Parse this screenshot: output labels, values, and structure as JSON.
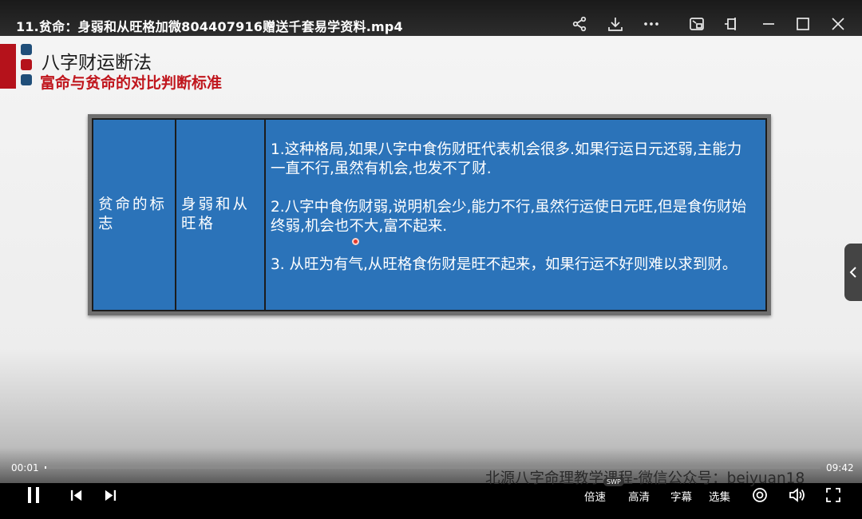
{
  "window": {
    "title": "11.贫命：身弱和从旺格加微804407916赠送千套易学资料.mp4"
  },
  "slide": {
    "heading": "八字财运断法",
    "subheading": "富命与贫命的对比判断标准",
    "table": {
      "col1": "贫命的标志",
      "col2": "身弱和从旺格",
      "paragraphs": [
        "1.这种格局,如果八字中食伤财旺代表机会很多.如果行运日元还弱,主能力一直不行,虽然有机会,也发不了财.",
        "2.八字中食伤财弱,说明机会少,能力不行,虽然行运使日元旺,但是食伤财始终弱,机会也不大,富不起来.",
        "3. 从旺为有气,从旺格食伤财是旺不起来，如果行运不好则难以求到财。"
      ]
    }
  },
  "player": {
    "watermark": "北源八字命理教学课程-微信公众号：beiyuan18",
    "current_time": "00:01",
    "total_time": "09:42",
    "progress": 0.002,
    "swp_badge": "SWP",
    "speed_label": "倍速",
    "quality_label": "高清",
    "subtitle_label": "字幕",
    "episodes_label": "选集"
  },
  "colors": {
    "table_blue": "#2b73b9",
    "accent_red": "#c0161d"
  }
}
